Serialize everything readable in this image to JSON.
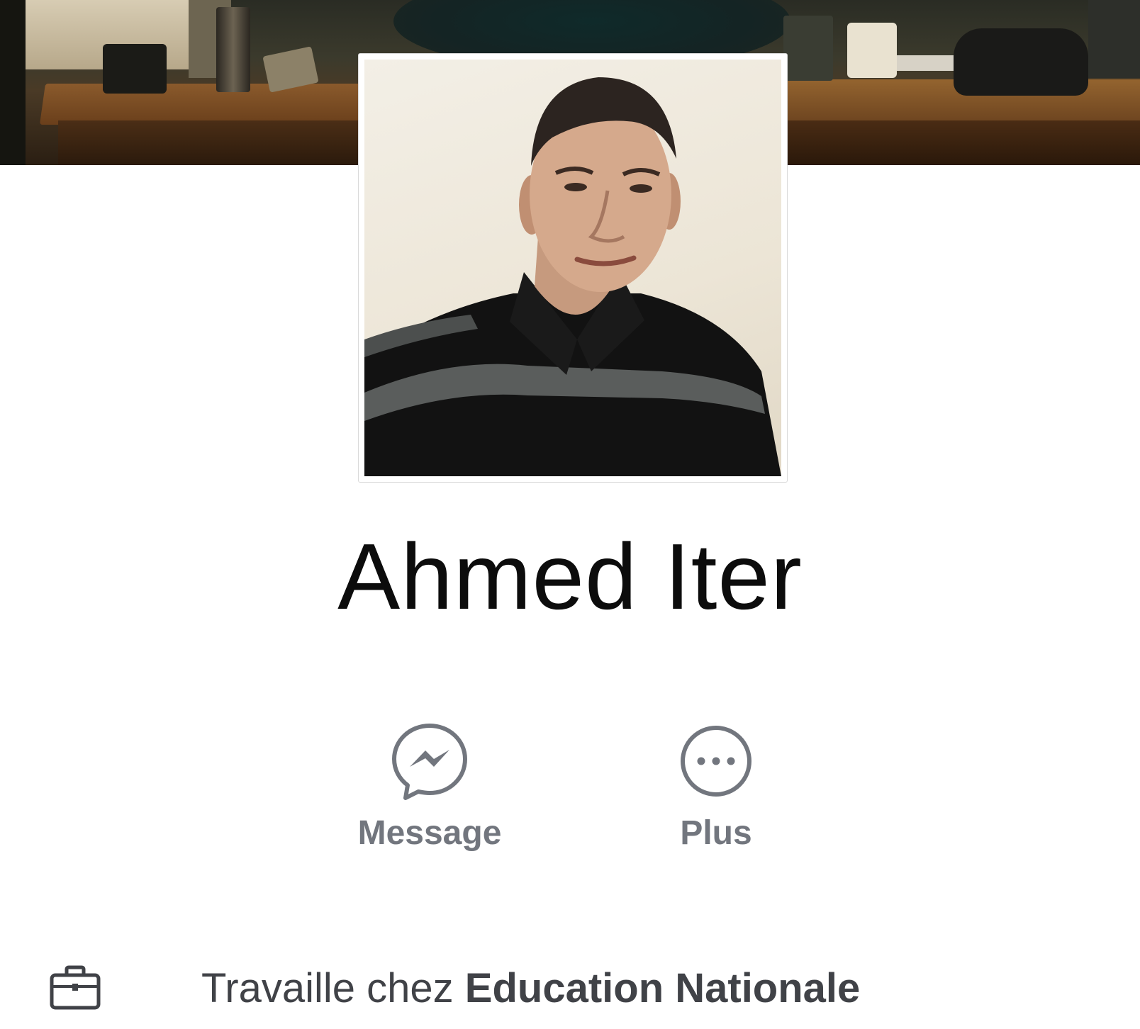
{
  "profile": {
    "name": "Ahmed Iter"
  },
  "actions": {
    "message_label": "Message",
    "more_label": "Plus"
  },
  "work": {
    "prefix": "Travaille chez",
    "employer": "Education Nationale"
  },
  "icons": {
    "message": "messenger-icon",
    "more": "more-dots-icon",
    "work": "briefcase-icon"
  },
  "colors": {
    "icon_gray": "#72767e",
    "text_dark": "#404247",
    "name_black": "#0c0c0c"
  }
}
